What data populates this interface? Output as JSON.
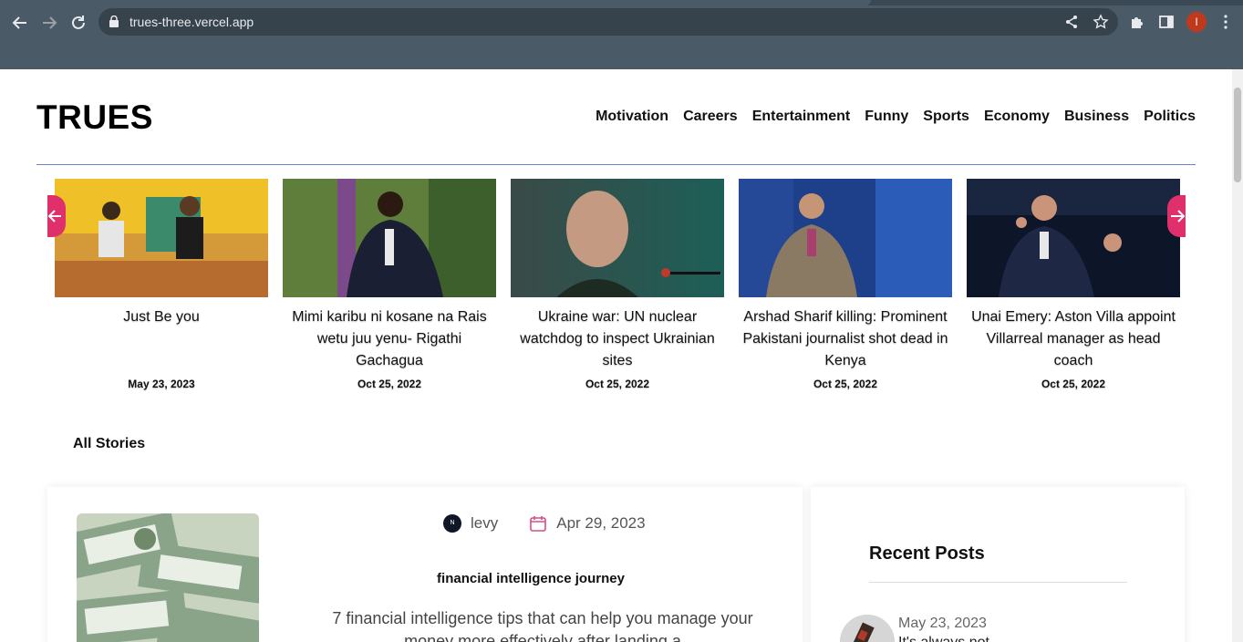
{
  "browser": {
    "url": "trues-three.vercel.app",
    "profile_initial": "I",
    "icons": {
      "back": "back-arrow-icon",
      "forward": "forward-arrow-icon",
      "reload": "reload-icon",
      "lock": "lock-icon",
      "share": "share-icon",
      "bookmark": "star-icon",
      "extensions": "puzzle-icon",
      "sidepanel": "side-panel-icon",
      "menu": "kebab-menu-icon"
    }
  },
  "site": {
    "logo": "TRUES",
    "nav": [
      "Motivation",
      "Careers",
      "Entertainment",
      "Funny",
      "Sports",
      "Economy",
      "Business",
      "Politics"
    ]
  },
  "carousel": {
    "accent_color": "#e0306b",
    "items": [
      {
        "title": "Just Be you",
        "date": "May 23, 2023"
      },
      {
        "title": "Mimi karibu ni kosane na Rais wetu juu yenu- Rigathi Gachagua",
        "date": "Oct 25, 2022"
      },
      {
        "title": "Ukraine war: UN nuclear watchdog to inspect Ukrainian sites",
        "date": "Oct 25, 2022"
      },
      {
        "title": "Arshad Sharif killing: Prominent Pakistani journalist shot dead in Kenya",
        "date": "Oct 25, 2022"
      },
      {
        "title": "Unai Emery: Aston Villa appoint Villarreal manager as head coach",
        "date": "Oct 25, 2022"
      }
    ]
  },
  "stories": {
    "heading": "All Stories",
    "featured": {
      "author": "levy",
      "author_badge": "N",
      "date": "Apr 29, 2023",
      "category": "financial intelligence journey",
      "excerpt": "7 financial intelligence tips that can help you manage your money more effectively after landing a"
    }
  },
  "recent_posts": {
    "heading": "Recent Posts",
    "items": [
      {
        "date": "May 23, 2023",
        "title": "It's always not"
      }
    ]
  }
}
